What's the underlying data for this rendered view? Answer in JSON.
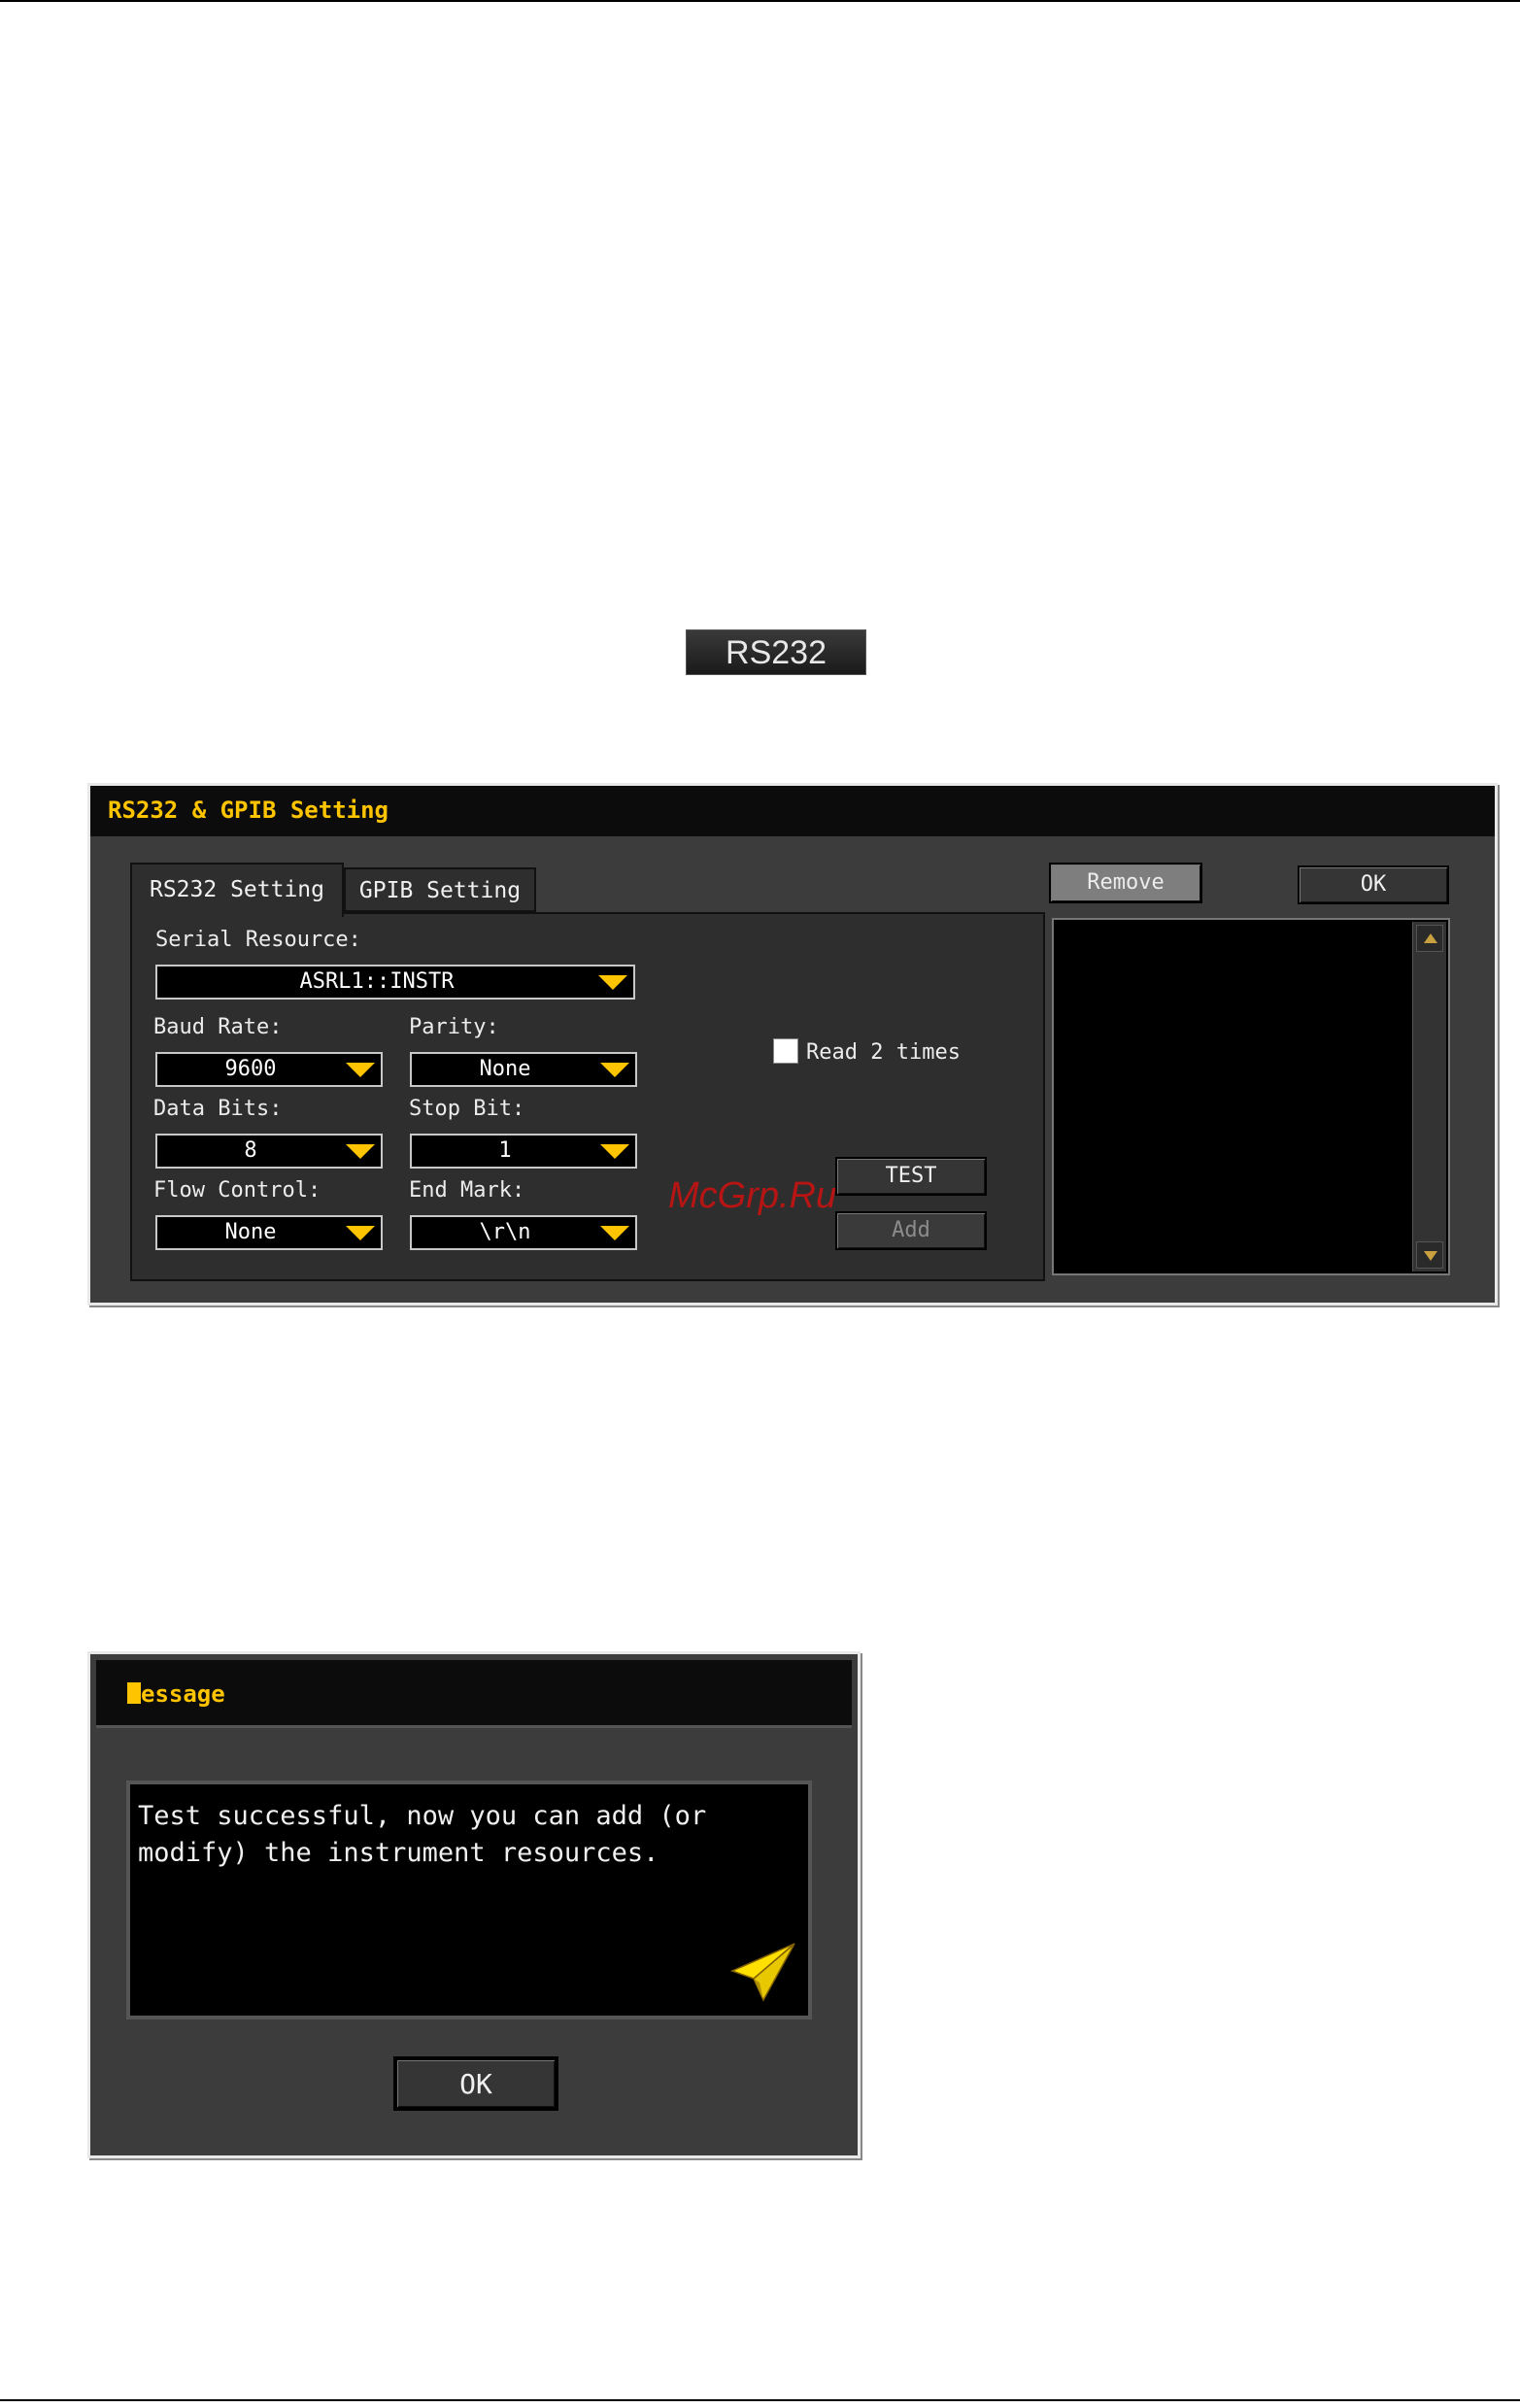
{
  "rs232_button": {
    "label": "RS232"
  },
  "settings_dialog": {
    "title": "RS232 & GPIB Setting",
    "tabs": [
      {
        "label": "RS232 Setting"
      },
      {
        "label": "GPIB Setting"
      }
    ],
    "serial_resource": {
      "label": "Serial Resource:",
      "value": "ASRL1::INSTR"
    },
    "baud_rate": {
      "label": "Baud Rate:",
      "value": "9600"
    },
    "parity": {
      "label": "Parity:",
      "value": "None"
    },
    "data_bits": {
      "label": "Data Bits:",
      "value": "8"
    },
    "stop_bit": {
      "label": "Stop Bit:",
      "value": "1"
    },
    "flow_control": {
      "label": "Flow Control:",
      "value": "None"
    },
    "end_mark": {
      "label": "End Mark:",
      "value": "\\r\\n"
    },
    "read_twice": {
      "label": "Read 2 times",
      "checked": false
    },
    "test_button": "TEST",
    "add_button": "Add",
    "remove_button": "Remove",
    "ok_button": "OK",
    "resource_list": []
  },
  "message_dialog": {
    "title": "essage",
    "text_line1": "Test successful, now you can add (or",
    "text_line2": "modify) the instrument resources.",
    "ok_button": "OK",
    "icon": "paper-plane-icon"
  },
  "watermark": "McGrp.Ru",
  "colors": {
    "title_accent": "#ffc400",
    "arrow": "#ffc400",
    "dialog_bg": "#3c3c3c"
  }
}
